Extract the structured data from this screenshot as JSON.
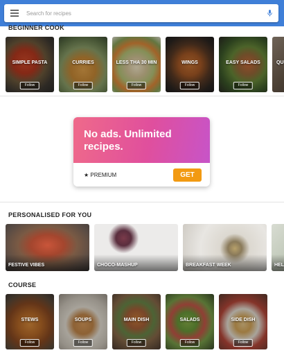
{
  "search": {
    "placeholder": "Search for recipes"
  },
  "sections": {
    "beginner": {
      "title": "BEGINNER COOK",
      "follow_label": "Follow",
      "cards": [
        {
          "title": "SIMPLE PASTA"
        },
        {
          "title": "CURRIES"
        },
        {
          "title": "LESS THA 30 MIN"
        },
        {
          "title": "WINGS"
        },
        {
          "title": "EASY SALADS"
        },
        {
          "title": "QU"
        }
      ]
    },
    "personalised": {
      "title": "PERSONALISED FOR YOU",
      "cards": [
        {
          "title": "FESTIVE VIBES"
        },
        {
          "title": "CHOCO-MASHUP"
        },
        {
          "title": "BREAKFAST WEEK"
        },
        {
          "title": "HEL"
        }
      ]
    },
    "course": {
      "title": "COURSE",
      "follow_label": "Follow",
      "cards": [
        {
          "title": "STEWS"
        },
        {
          "title": "SOUPS"
        },
        {
          "title": "MAIN DISH"
        },
        {
          "title": "SALADS"
        },
        {
          "title": "SIDE DISH"
        }
      ]
    }
  },
  "promo": {
    "headline": "No ads. Unlimited recipes.",
    "premium_label": "★ PREMIUM",
    "get_label": "GET"
  },
  "colors": {
    "topbar": "#3f7fd8",
    "get_button": "#f29a12",
    "promo_start": "#ef6a8a",
    "promo_end": "#c754c8"
  }
}
